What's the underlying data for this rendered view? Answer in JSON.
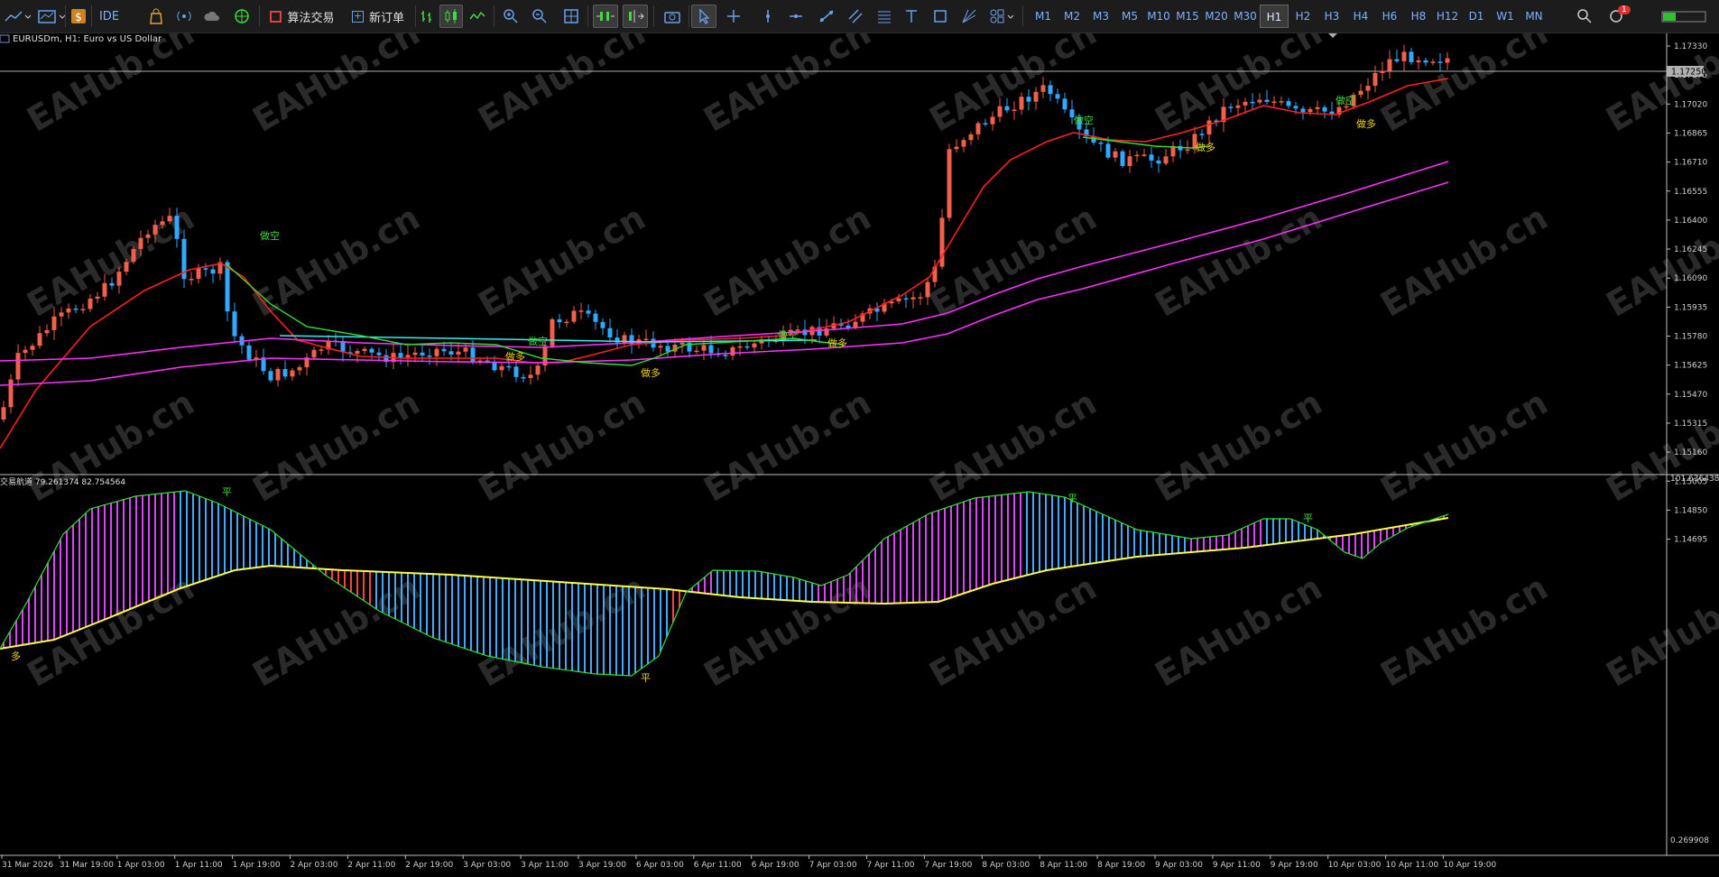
{
  "toolbar": {
    "ide_label": "IDE",
    "algo_label": "算法交易",
    "neworder_label": "新订单",
    "timeframes": [
      "M1",
      "M2",
      "M3",
      "M5",
      "M10",
      "M15",
      "M20",
      "M30",
      "H1",
      "H2",
      "H3",
      "H4",
      "H6",
      "H8",
      "H12",
      "D1",
      "W1",
      "MN"
    ],
    "active_timeframe": "H1",
    "notification_count": "1"
  },
  "chart": {
    "symbol_info": "EURUSDm, H1:  Euro vs US Dollar",
    "indicator_info": "交易航道 79.261374 82.754564",
    "current_price": "1.17250",
    "watermark": "EAHub.cn",
    "price_ticks": [
      "1.17330",
      "1.17175",
      "1.17020",
      "1.16865",
      "1.16710",
      "1.16555",
      "1.16400",
      "1.16245",
      "1.16090",
      "1.15935",
      "1.15780",
      "1.15625",
      "1.15470",
      "1.15315",
      "1.15160",
      "1.15005",
      "1.14850",
      "1.14695"
    ],
    "indicator_ticks": [
      "101.636438",
      "0.269908"
    ],
    "time_ticks": [
      "31 Mar 2026",
      "31 Mar 19:00",
      "1 Apr 03:00",
      "1 Apr 11:00",
      "1 Apr 19:00",
      "2 Apr 03:00",
      "2 Apr 11:00",
      "2 Apr 19:00",
      "3 Apr 03:00",
      "3 Apr 11:00",
      "3 Apr 19:00",
      "6 Apr 03:00",
      "6 Apr 11:00",
      "6 Apr 19:00",
      "7 Apr 03:00",
      "7 Apr 11:00",
      "7 Apr 19:00",
      "8 Apr 03:00",
      "8 Apr 11:00",
      "8 Apr 19:00",
      "9 Apr 03:00",
      "9 Apr 11:00",
      "9 Apr 19:00",
      "10 Apr 03:00",
      "10 Apr 11:00",
      "10 Apr 19:00"
    ],
    "signals": [
      {
        "text": "做空",
        "color": "#3cdc3c"
      },
      {
        "text": "做空",
        "color": "#3cdc3c"
      },
      {
        "text": "做多",
        "color": "#f0d020"
      },
      {
        "text": "做多",
        "color": "#f0d020"
      },
      {
        "text": "做空",
        "color": "#3cdc3c"
      },
      {
        "text": "做多",
        "color": "#f0d020"
      },
      {
        "text": "做空",
        "color": "#3cdc3c"
      },
      {
        "text": "做多",
        "color": "#f0d020"
      },
      {
        "text": "做空",
        "color": "#3cdc3c"
      },
      {
        "text": "做多",
        "color": "#f0d020"
      }
    ],
    "indicator_signals": [
      {
        "text": "多",
        "color": "#f0d020"
      },
      {
        "text": "平",
        "color": "#3cdc3c"
      },
      {
        "text": "平",
        "color": "#f0d020"
      },
      {
        "text": "平",
        "color": "#3cdc3c"
      },
      {
        "text": "平",
        "color": "#3cdc3c"
      }
    ],
    "colors": {
      "up": "#f0604a",
      "down": "#30a8ff",
      "ma_red": "#ff2020",
      "ma_magenta": "#ff30ff",
      "ma_cyan": "#30f0f0",
      "ma_green": "#30e030",
      "ind_yellow": "#ffff40",
      "ind_hist_red": "#ff4040",
      "ind_hist_magenta": "#e040ff",
      "ind_hist_blue": "#40a8ff"
    }
  }
}
